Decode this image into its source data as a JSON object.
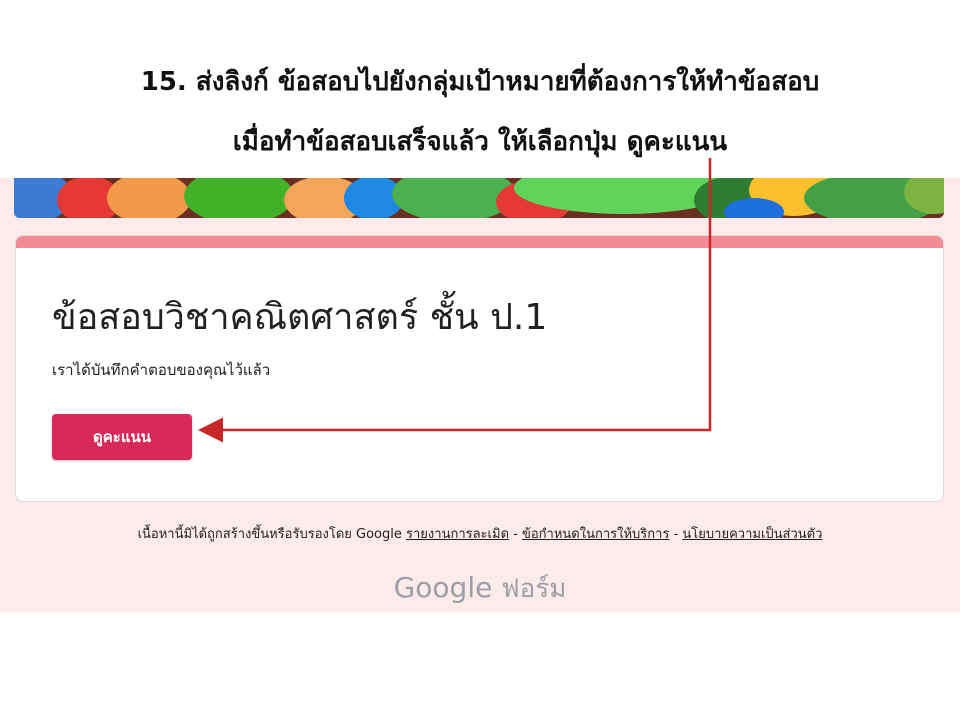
{
  "instruction": {
    "line1": "15. ส่งลิงก์ ข้อสอบไปยังกลุ่มเป้าหมายที่ต้องการให้ทำข้อสอบ",
    "line2": "เมื่อทำข้อสอบเสร็จแล้ว ให้เลือกปุ่ม ดูคะแนน"
  },
  "form": {
    "title": "ข้อสอบวิชาคณิตศาสตร์ ชั้น ป.1",
    "message": "เราได้บันทึกคำตอบของคุณไว้แล้ว",
    "view_score_label": "ดูคะแนน",
    "accent_color": "#f28b95",
    "button_color": "#d9295a"
  },
  "footer": {
    "note": "เนื้อหานี้มิได้ถูกสร้างขึ้นหรือรับรองโดย Google",
    "link_report": "รายงานการละเมิด",
    "sep1": " - ",
    "link_terms": "ข้อกำหนดในการให้บริการ",
    "sep2": " - ",
    "link_privacy": "นโยบายความเป็นส่วนตัว"
  },
  "logo": {
    "google": "Google",
    "forms": "ฟอร์ม"
  }
}
